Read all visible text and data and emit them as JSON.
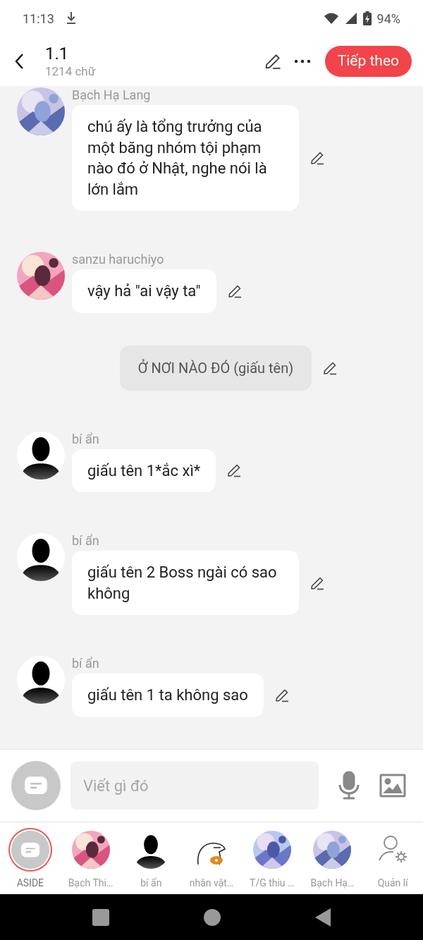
{
  "status_bar": {
    "time": "11:13",
    "battery": "94%"
  },
  "header": {
    "title": "1.1",
    "subtitle": "1214 chữ",
    "next_button": "Tiếp theo"
  },
  "messages": [
    {
      "kind": "message",
      "name": "Bạch Hạ Lang",
      "text": "chú ấy là tổng trưởng của một băng nhóm tội phạm nào đó ở Nhật, nghe nói là lớn lắm"
    },
    {
      "kind": "message",
      "name": "sanzu haruchiyo",
      "text": "vậy hả \"ai vậy ta\""
    },
    {
      "kind": "narration",
      "text": "Ở NƠI NÀO ĐÓ (giấu tên)"
    },
    {
      "kind": "message",
      "avatar": {
        "kind": "silhouette"
      },
      "name": "bí ẩn",
      "text": "giấu tên 1*ắc xì*"
    },
    {
      "kind": "message",
      "avatar": {
        "kind": "silhouette"
      },
      "name": "bí ẩn",
      "text": "giấu tên 2 Boss ngài có sao không"
    },
    {
      "kind": "message",
      "avatar": {
        "kind": "silhouette"
      },
      "name": "bí ẩn",
      "text": "giấu tên 1 ta không sao"
    }
  ],
  "composer": {
    "placeholder": "Viết gì đó"
  },
  "characters": [
    {
      "kind": "aside",
      "label": "ASIDE",
      "selected": true
    },
    {
      "kind": "picture",
      "label": "Bạch Thi…",
      "selected": false
    },
    {
      "kind": "silhouette",
      "label": "bí ẩn",
      "selected": false
    },
    {
      "kind": "sketch",
      "label": "nhân vật…",
      "selected": false
    },
    {
      "kind": "picture",
      "label": "T/G thiu …",
      "selected": false
    },
    {
      "kind": "picture",
      "label": "Bạch Hạ…",
      "selected": false
    },
    {
      "kind": "manage",
      "label": "Quản lí",
      "selected": false
    }
  ]
}
